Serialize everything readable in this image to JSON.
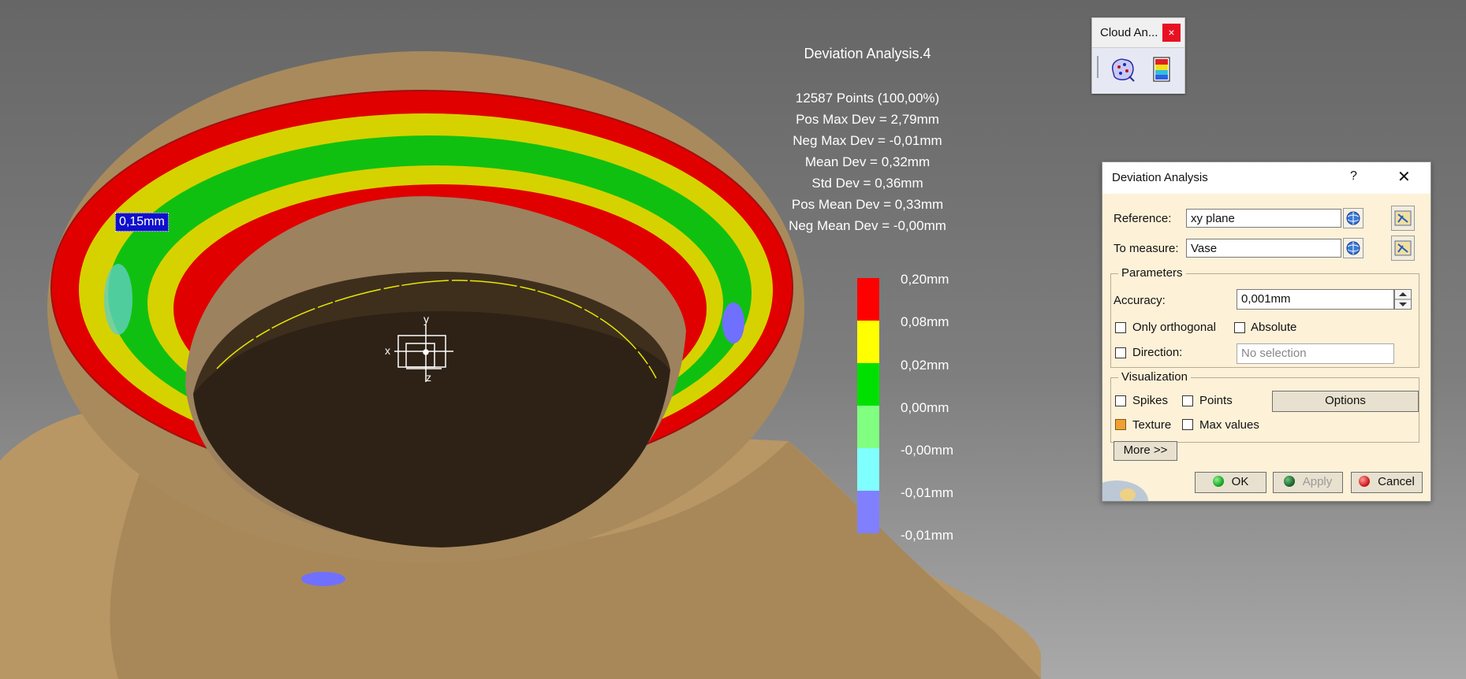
{
  "viewport": {
    "point_label": "0,15mm",
    "stats_title": "Deviation Analysis.4",
    "stats": [
      "12587 Points (100,00%)",
      "Pos Max Dev = 2,79mm",
      "Neg Max Dev = -0,01mm",
      "Mean Dev = 0,32mm",
      "Std Dev = 0,36mm",
      "Pos Mean Dev = 0,33mm",
      "Neg Mean Dev = -0,00mm"
    ],
    "axis_labels": {
      "x": "x",
      "y": "y",
      "z": "z"
    },
    "color_scale": [
      {
        "label": "0,20mm",
        "color": "#ff0000"
      },
      {
        "label": "0,08mm",
        "color": "#ffff00"
      },
      {
        "label": "0,02mm",
        "color": "#00e000"
      },
      {
        "label": "0,00mm",
        "color": "#80ff80"
      },
      {
        "label": "-0,00mm",
        "color": "#80ffff"
      },
      {
        "label": "-0,01mm",
        "color": "#8080ff"
      },
      {
        "label": "-0,01mm",
        "color": ""
      }
    ],
    "colors": {
      "surface": "#b89765",
      "inner": "#2e2216",
      "highlight_edge": "#e8e800"
    }
  },
  "cloud_toolbar": {
    "title": "Cloud An...",
    "close_label": "×",
    "icons": [
      "cloud-analysis-icon",
      "deviation-color-icon"
    ]
  },
  "dialog": {
    "title": "Deviation Analysis",
    "help_label": "?",
    "close_label": "✕",
    "reference": {
      "label": "Reference:",
      "value": "xy plane"
    },
    "to_measure": {
      "label": "To measure:",
      "value": "Vase"
    },
    "parameters": {
      "title": "Parameters",
      "accuracy_label": "Accuracy:",
      "accuracy_value": "0,001mm",
      "only_orthogonal": {
        "label": "Only orthogonal",
        "checked": false
      },
      "absolute": {
        "label": "Absolute",
        "checked": false
      },
      "direction": {
        "label": "Direction:",
        "checked": false
      },
      "direction_placeholder": "No selection"
    },
    "visualization": {
      "title": "Visualization",
      "spikes": {
        "label": "Spikes",
        "checked": false
      },
      "points": {
        "label": "Points",
        "checked": false
      },
      "options_label": "Options",
      "texture": {
        "label": "Texture",
        "checked": true
      },
      "max_values": {
        "label": "Max values",
        "checked": false
      }
    },
    "more_label": "More >>",
    "ok_label": "OK",
    "apply_label": "Apply",
    "cancel_label": "Cancel",
    "colors": {
      "ok": "#1faa2a",
      "apply": "#1f6a30",
      "cancel": "#d42020"
    }
  }
}
